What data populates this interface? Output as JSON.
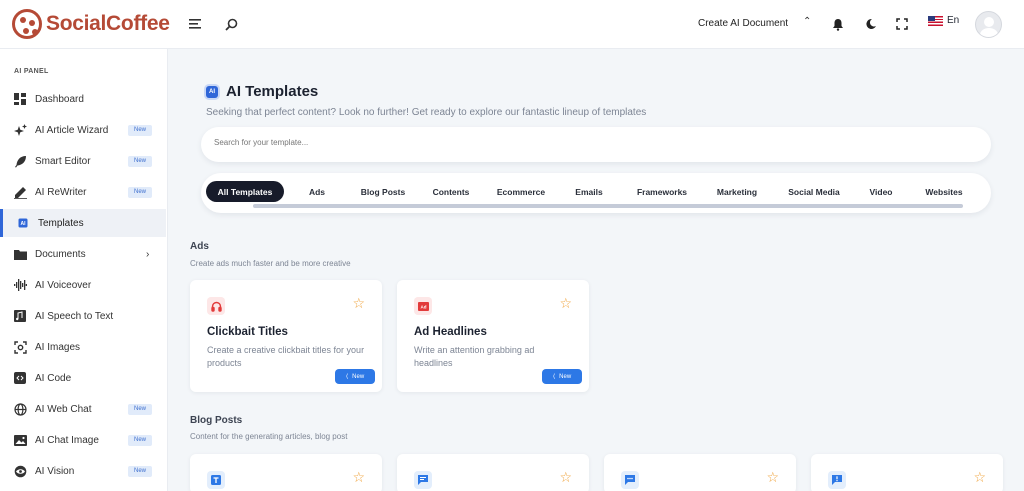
{
  "brand": {
    "name": "SocialCoffee",
    "color": "#b54a36"
  },
  "topbar": {
    "create_label": "Create AI Document",
    "language": "En",
    "icons": [
      "menu-icon",
      "search-icon",
      "chevron-up-icon",
      "bell-icon",
      "moon-icon",
      "fullscreen-icon",
      "flag-icon",
      "avatar"
    ]
  },
  "sidebar": {
    "section_label": "AI PANEL",
    "items": [
      {
        "label": "Dashboard",
        "icon": "dashboard-icon"
      },
      {
        "label": "AI Article Wizard",
        "icon": "sparkle-icon",
        "badge": "New"
      },
      {
        "label": "Smart Editor",
        "icon": "feather-icon",
        "badge": "New"
      },
      {
        "label": "AI ReWriter",
        "icon": "pen-icon",
        "badge": "New"
      },
      {
        "label": "Templates",
        "icon": "ai-chip-icon",
        "active": true
      },
      {
        "label": "Documents",
        "icon": "folder-icon",
        "has_submenu": true
      },
      {
        "label": "AI Voiceover",
        "icon": "waveform-icon"
      },
      {
        "label": "AI Speech to Text",
        "icon": "audio-file-icon"
      },
      {
        "label": "AI Images",
        "icon": "image-frame-icon"
      },
      {
        "label": "AI Code",
        "icon": "code-icon"
      },
      {
        "label": "AI Web Chat",
        "icon": "globe-icon",
        "badge": "New"
      },
      {
        "label": "AI Chat Image",
        "icon": "picture-icon",
        "badge": "New"
      },
      {
        "label": "AI Vision",
        "icon": "eye-globe-icon",
        "badge": "New"
      }
    ]
  },
  "main": {
    "ai_badge": "AI",
    "title": "AI Templates",
    "subtitle": "Seeking that perfect content? Look no further! Get ready to explore our fantastic lineup of templates",
    "search_placeholder": "Search for your template...",
    "tabs": [
      "All Templates",
      "Ads",
      "Blog Posts",
      "Contents",
      "Ecommerce",
      "Emails",
      "Frameworks",
      "Marketing",
      "Social Media",
      "Video",
      "Websites"
    ],
    "active_tab": "All Templates",
    "sections": [
      {
        "title": "Ads",
        "description": "Create ads much faster and be more creative",
        "cards": [
          {
            "title": "Clickbait Titles",
            "description": "Create a creative clickbait titles for your products",
            "icon": "headphones-icon",
            "button": "New"
          },
          {
            "title": "Ad Headlines",
            "description": "Write an attention grabbing ad headlines",
            "icon": "ad-icon",
            "button": "New"
          }
        ]
      },
      {
        "title": "Blog Posts",
        "description": "Content for the generating articles, blog post",
        "cards": [
          {
            "icon": "text-box-icon"
          },
          {
            "icon": "message-lines-icon"
          },
          {
            "icon": "chat-dots-icon"
          },
          {
            "icon": "alert-box-icon"
          }
        ]
      }
    ]
  },
  "colors": {
    "accent": "#2f66d8",
    "button": "#2d78e6",
    "star": "#f0a33b",
    "active_tab_bg": "#171b2a",
    "badge_bg": "#e1ebfa"
  }
}
